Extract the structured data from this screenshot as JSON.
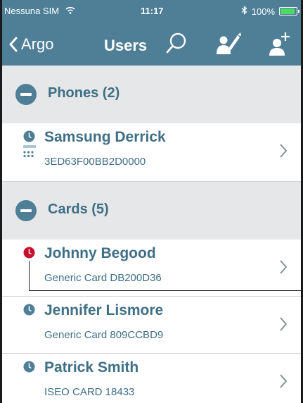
{
  "status_bar": {
    "carrier": "Nessuna SIM",
    "time": "11:17",
    "battery": "100%",
    "wifi_icon": "wifi-icon",
    "bluetooth_icon": "bluetooth-icon",
    "battery_level": 1.0
  },
  "navbar": {
    "back_label": "Argo",
    "title": "Users",
    "icons": [
      "search-icon",
      "assign-user-icon",
      "add-user-icon"
    ]
  },
  "sections": {
    "phones": {
      "title": "Phones (2)",
      "items": [
        {
          "name": "Samsung Derrick",
          "detail": "3ED63F00BB2D0000",
          "status_color": "#4e7f97"
        }
      ]
    },
    "cards": {
      "title": "Cards (5)",
      "items": [
        {
          "name": "Johnny Begood",
          "detail": "Generic Card DB200D36",
          "status_color": "#c8102e"
        },
        {
          "name": "Jennifer Lismore",
          "detail": "Generic Card 809CCBD9",
          "status_color": "#4e7f97"
        },
        {
          "name": "Patrick Smith",
          "detail": "ISEO CARD 18433",
          "status_color": "#4e7f97"
        }
      ]
    }
  },
  "colors": {
    "accent": "#4e7f97",
    "alert": "#c8102e",
    "section_bg": "#e6e7e8",
    "text": "#3e6f86"
  }
}
